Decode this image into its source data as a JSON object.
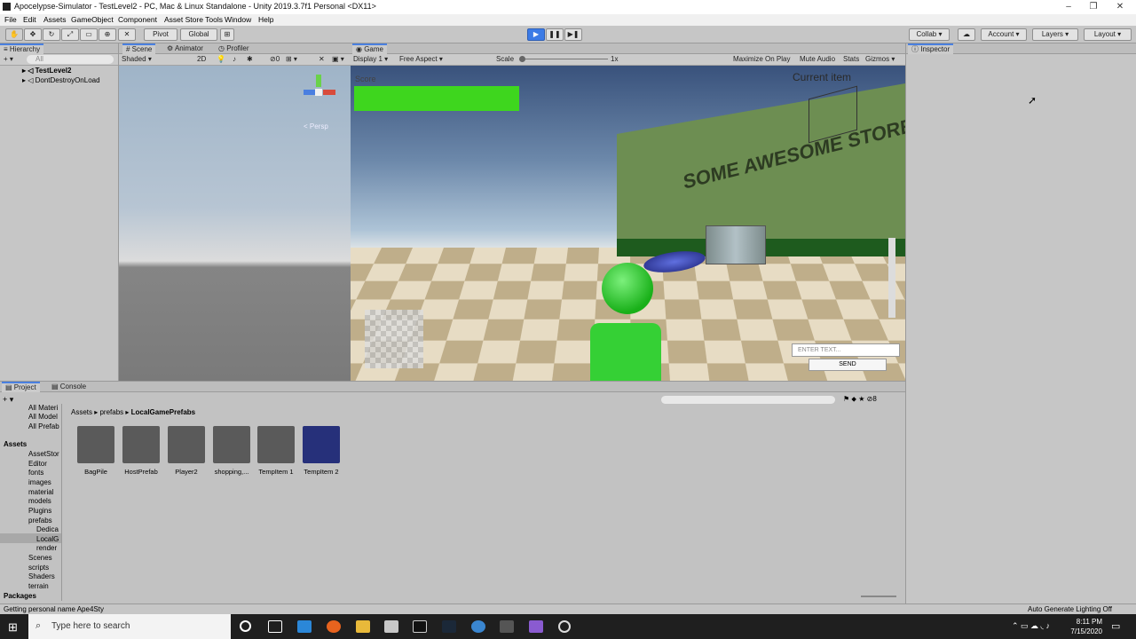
{
  "window": {
    "title": "Apocelypse-Simulator - TestLevel2 - PC, Mac & Linux Standalone - Unity 2019.3.7f1 Personal <DX11>"
  },
  "menu": [
    "File",
    "Edit",
    "Assets",
    "GameObject",
    "Component",
    "Asset Store Tools",
    "Window",
    "Help"
  ],
  "toolbar": {
    "pivot": "Pivot",
    "global": "Global",
    "collab": "Collab",
    "account": "Account",
    "layers": "Layers",
    "layout": "Layout"
  },
  "hierarchy": {
    "tab": "Hierarchy",
    "search_placeholder": "All",
    "items": [
      "TestLevel2",
      "DontDestroyOnLoad"
    ]
  },
  "scene": {
    "tabs": [
      "Scene",
      "Animator",
      "Profiler"
    ],
    "shading": "Shaded",
    "mode2d": "2D",
    "persp": "< Persp",
    "layer_count": "0"
  },
  "game": {
    "tab": "Game",
    "display": "Display 1",
    "aspect": "Free Aspect",
    "scale_label": "Scale",
    "scale_value": "1x",
    "maximize": "Maximize On Play",
    "mute": "Mute Audio",
    "stats": "Stats",
    "gizmos": "Gizmos",
    "score_label": "Score",
    "current_item": "Current item",
    "store_sign": "SOME AWESOME STORE NAME",
    "chat_placeholder": "ENTER TEXT...",
    "send": "SEND"
  },
  "inspector": {
    "tab": "Inspector"
  },
  "project": {
    "tabs": [
      "Project",
      "Console"
    ],
    "breadcrumb": [
      "Assets",
      "prefabs",
      "LocalGamePrefabs"
    ],
    "favorites": [
      "All Materi",
      "All Model",
      "All Prefab"
    ],
    "tree": [
      "Assets",
      "AssetStor",
      "Editor",
      "fonts",
      "images",
      "material",
      "models",
      "Plugins",
      "prefabs",
      "Dedica",
      "LocalG",
      "render",
      "Scenes",
      "scripts",
      "Shaders",
      "terrain",
      "Packages"
    ],
    "assets": [
      "BagPile",
      "HostPrefab",
      "Player2",
      "shopping,...",
      "TempItem 1",
      "TempItem 2"
    ],
    "hidden_count": "8"
  },
  "status": {
    "message": "Getting personal name Ape4Sty",
    "lighting": "Auto Generate Lighting Off"
  },
  "taskbar": {
    "search_placeholder": "Type here to search",
    "time": "8:11 PM",
    "date": "7/15/2020"
  }
}
